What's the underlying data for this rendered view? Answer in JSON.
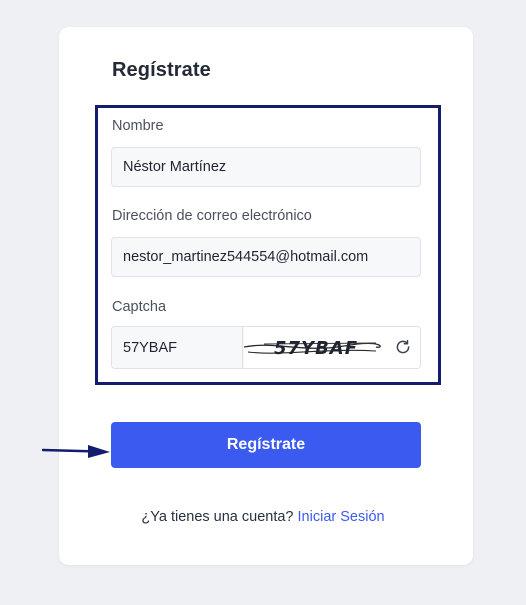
{
  "form": {
    "title": "Regístrate",
    "name_label": "Nombre",
    "name_value": "Néstor Martínez",
    "email_label": "Dirección de correo electrónico",
    "email_value": "nestor_martinez544554@hotmail.com",
    "captcha_label": "Captcha",
    "captcha_value": "57YBAF",
    "captcha_image_text": "57YBAF",
    "submit_label": "Regístrate"
  },
  "footer": {
    "prompt": "¿Ya tienes una cuenta?",
    "login_link": "Iniciar Sesión"
  },
  "icons": {
    "refresh": "refresh-icon",
    "arrow": "arrow-right-icon"
  },
  "colors": {
    "primary": "#3b5bf0",
    "highlight_border": "#141c6e",
    "arrow": "#141c6e"
  }
}
